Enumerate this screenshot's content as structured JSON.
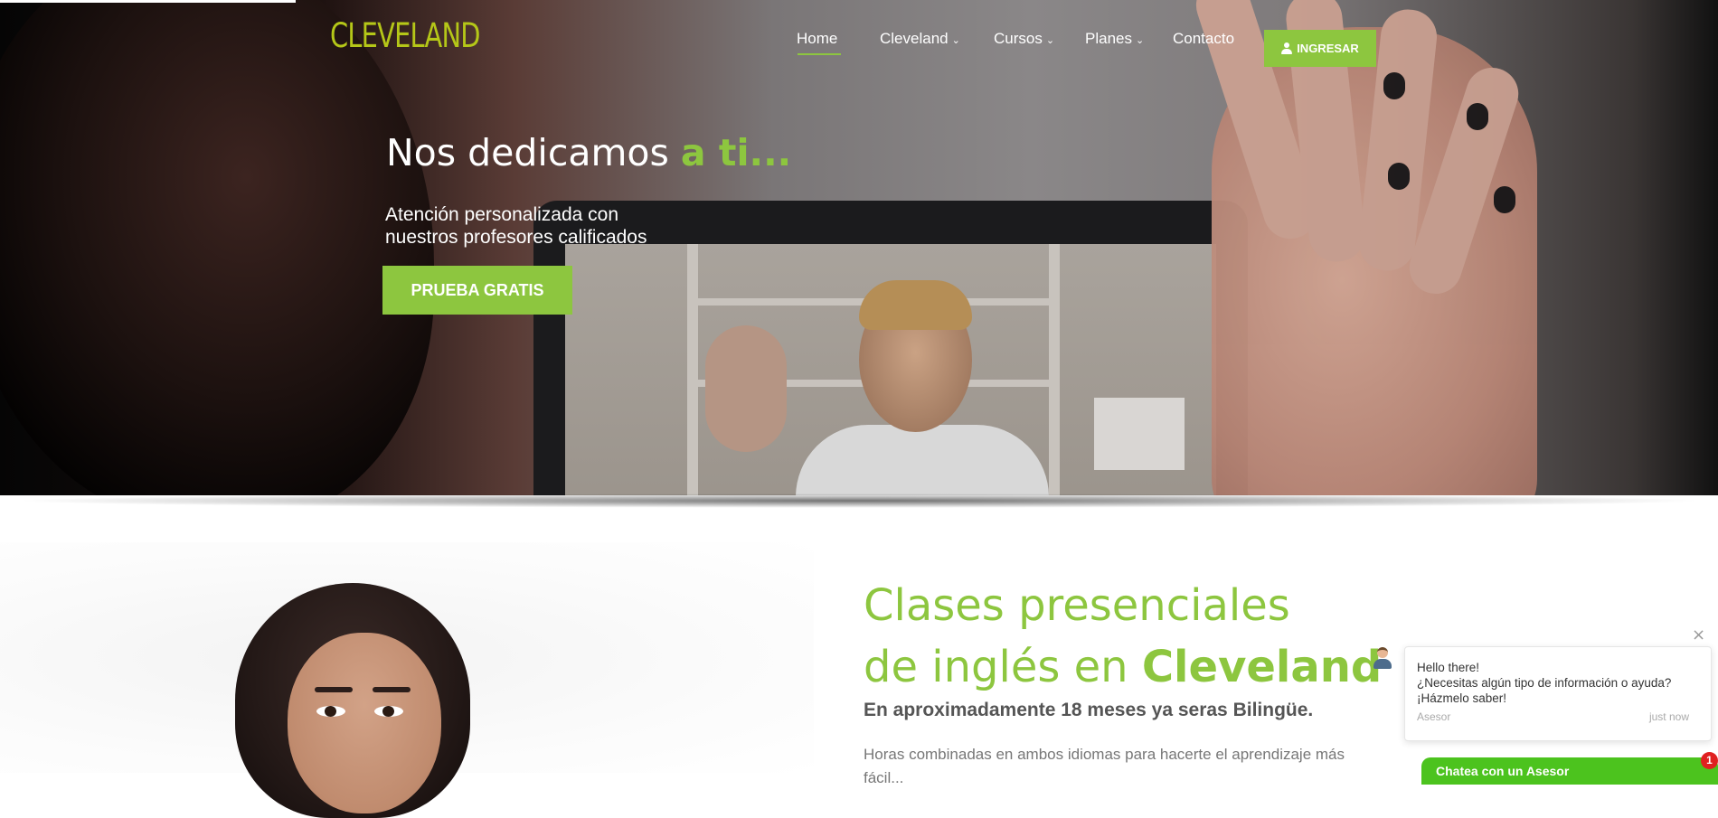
{
  "brand": {
    "logo": "CLEVELAND",
    "accent": "#8dc63f",
    "logo_color": "#b5c718"
  },
  "nav": {
    "items": [
      {
        "label": "Home",
        "active": true
      },
      {
        "label": "Cleveland",
        "dropdown": true
      },
      {
        "label": "Cursos",
        "dropdown": true
      },
      {
        "label": "Planes",
        "dropdown": true
      },
      {
        "label": "Contacto"
      }
    ],
    "login": {
      "label": "INGRESAR",
      "icon": "user-icon"
    },
    "chevron": "⌄"
  },
  "hero": {
    "title_main": "Nos dedicamos ",
    "title_accent": "a ti...",
    "subtitle_line1": "Atención personalizada con",
    "subtitle_line2": "nuestros profesores calificados",
    "cta": "PRUEBA GRATIS"
  },
  "section": {
    "title_line1": "Clases presenciales",
    "title_line2_prefix": "de inglés en ",
    "title_line2_bold": "Cleveland",
    "subtitle": "En aproximadamente 18 meses ya seras Bilingüe.",
    "description": "Horas combinadas en ambos idiomas para hacerte el aprendizaje más fácil..."
  },
  "chat": {
    "line1": "Hello there!",
    "line2": "¿Necesitas algún tipo de información o ayuda?",
    "line3": "¡Házmelo saber!",
    "sender": "Asesor",
    "time": "just now",
    "close": "×",
    "button": "Chatea con un Asesor",
    "badge": "1"
  }
}
